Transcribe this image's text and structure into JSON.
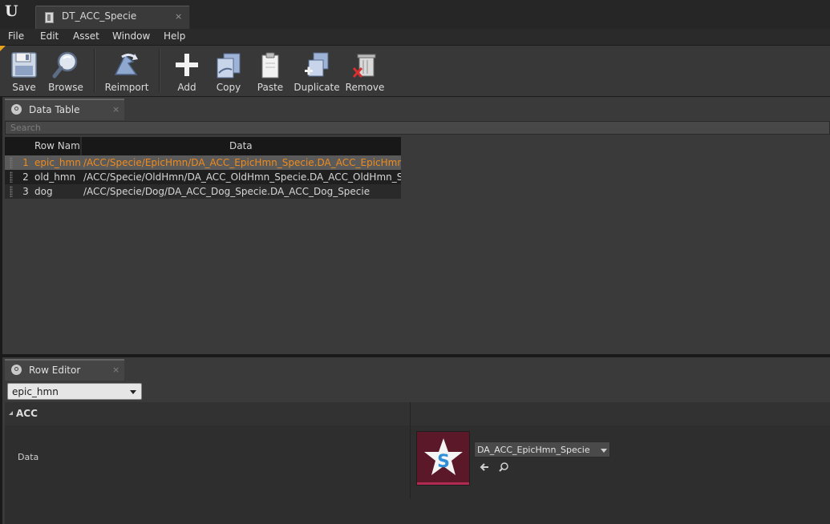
{
  "window": {
    "logo": "U",
    "document_tab": {
      "label": "DT_ACC_Specie",
      "close": "×"
    }
  },
  "menu": [
    "File",
    "Edit",
    "Asset",
    "Window",
    "Help"
  ],
  "toolbar": {
    "accent_color": "#e7a21c",
    "buttons": [
      {
        "label": "Save",
        "icon": "save-icon"
      },
      {
        "label": "Browse",
        "icon": "browse-icon"
      },
      {
        "label": "Reimport",
        "icon": "reimport-icon"
      },
      {
        "label": "Add",
        "icon": "add-icon"
      },
      {
        "label": "Copy",
        "icon": "copy-icon"
      },
      {
        "label": "Paste",
        "icon": "paste-icon"
      },
      {
        "label": "Duplicate",
        "icon": "duplicate-icon"
      },
      {
        "label": "Remove",
        "icon": "remove-icon"
      }
    ]
  },
  "data_table": {
    "tab_label": "Data Table",
    "close": "×",
    "search_placeholder": "Search",
    "columns": {
      "row_name": "Row Name",
      "data": "Data"
    },
    "selected_color": "#f08b1c",
    "rows": [
      {
        "num": "1",
        "name": "epic_hmn",
        "data": "/ACC/Specie/EpicHmn/DA_ACC_EpicHmn_Specie.DA_ACC_EpicHmn_Specie",
        "selected": true
      },
      {
        "num": "2",
        "name": "old_hmn",
        "data": "/ACC/Specie/OldHmn/DA_ACC_OldHmn_Specie.DA_ACC_OldHmn_Specie",
        "selected": false
      },
      {
        "num": "3",
        "name": "dog",
        "data": "/ACC/Specie/Dog/DA_ACC_Dog_Specie.DA_ACC_Dog_Specie",
        "selected": false
      }
    ]
  },
  "row_editor": {
    "tab_label": "Row Editor",
    "close": "×",
    "selected_row": "epic_hmn",
    "category": "ACC",
    "property_label": "Data",
    "asset_value": "DA_ACC_EpicHmn_Specie",
    "thumbnail_color": "#5a1828"
  }
}
